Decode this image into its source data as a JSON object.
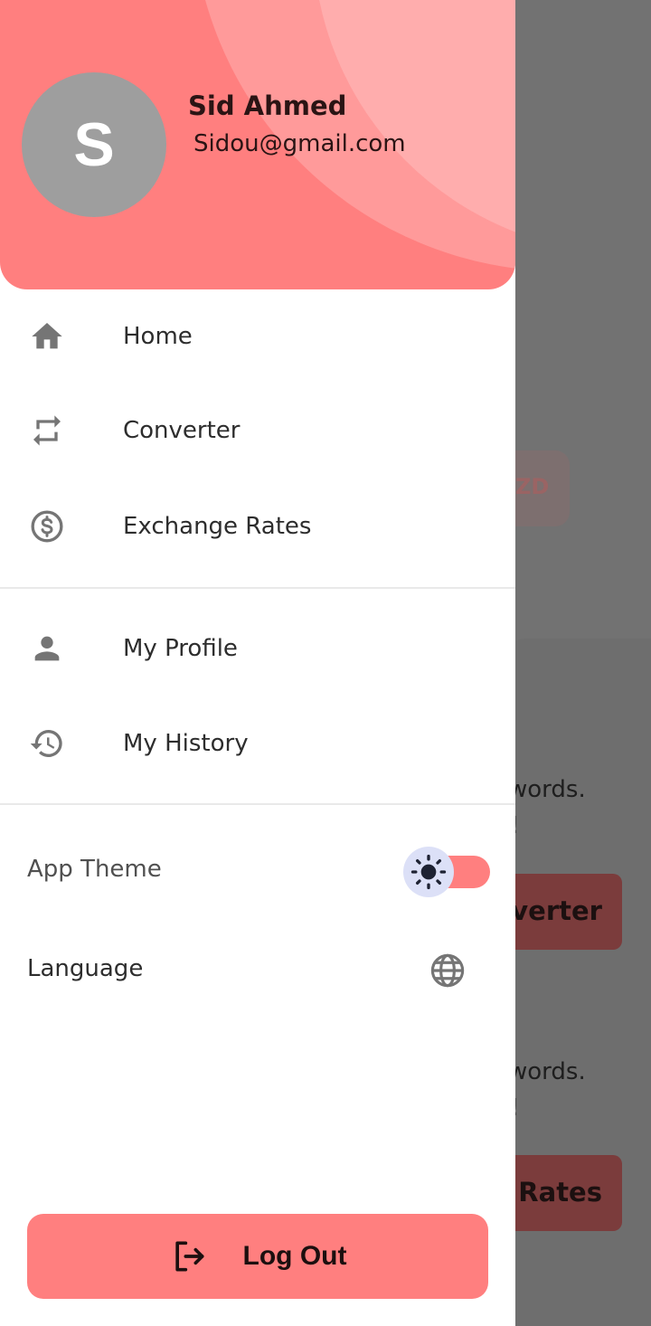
{
  "background": {
    "chip_text": "ZD",
    "line1": "words.",
    "line1b": "!",
    "button1": "verter",
    "line2": "words.",
    "line2b": "!",
    "button2": "Rates"
  },
  "header": {
    "avatar_letter": "S",
    "name": "Sid Ahmed",
    "email": "Sidou@gmail.com"
  },
  "nav": {
    "home": "Home",
    "converter": "Converter",
    "exchange_rates": "Exchange Rates",
    "my_profile": "My Profile",
    "my_history": "My History"
  },
  "settings": {
    "app_theme": "App Theme",
    "language": "Language",
    "theme_toggle_on": true
  },
  "logout": {
    "label": "Log Out"
  },
  "colors": {
    "accent": "#ff7f7f",
    "icon": "#757575",
    "scrim": "#727272"
  },
  "icons": {
    "home": "home-icon",
    "converter": "swap-icon",
    "exchange_rates": "dollar-circle-icon",
    "my_profile": "person-icon",
    "my_history": "history-icon",
    "theme": "sun-icon",
    "language": "globe-icon",
    "logout": "logout-icon"
  }
}
